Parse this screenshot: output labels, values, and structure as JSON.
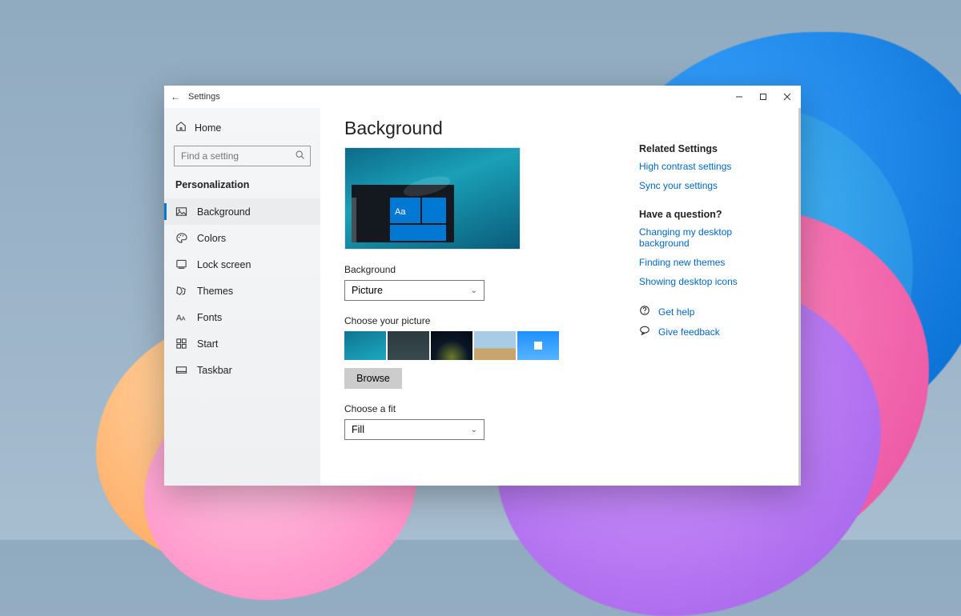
{
  "titlebar": {
    "back_glyph": "←",
    "app_title": "Settings"
  },
  "sidebar": {
    "home_label": "Home",
    "search_placeholder": "Find a setting",
    "category_label": "Personalization",
    "items": [
      {
        "label": "Background"
      },
      {
        "label": "Colors"
      },
      {
        "label": "Lock screen"
      },
      {
        "label": "Themes"
      },
      {
        "label": "Fonts"
      },
      {
        "label": "Start"
      },
      {
        "label": "Taskbar"
      }
    ]
  },
  "main": {
    "heading": "Background",
    "preview_tile_text": "Aa",
    "bg_label": "Background",
    "bg_value": "Picture",
    "choose_picture_label": "Choose your picture",
    "browse_label": "Browse",
    "fit_label": "Choose a fit",
    "fit_value": "Fill"
  },
  "right": {
    "related_heading": "Related Settings",
    "links_related": [
      "High contrast settings",
      "Sync your settings"
    ],
    "question_heading": "Have a question?",
    "links_question": [
      "Changing my desktop background",
      "Finding new themes",
      "Showing desktop icons"
    ],
    "help_label": "Get help",
    "feedback_label": "Give feedback"
  }
}
